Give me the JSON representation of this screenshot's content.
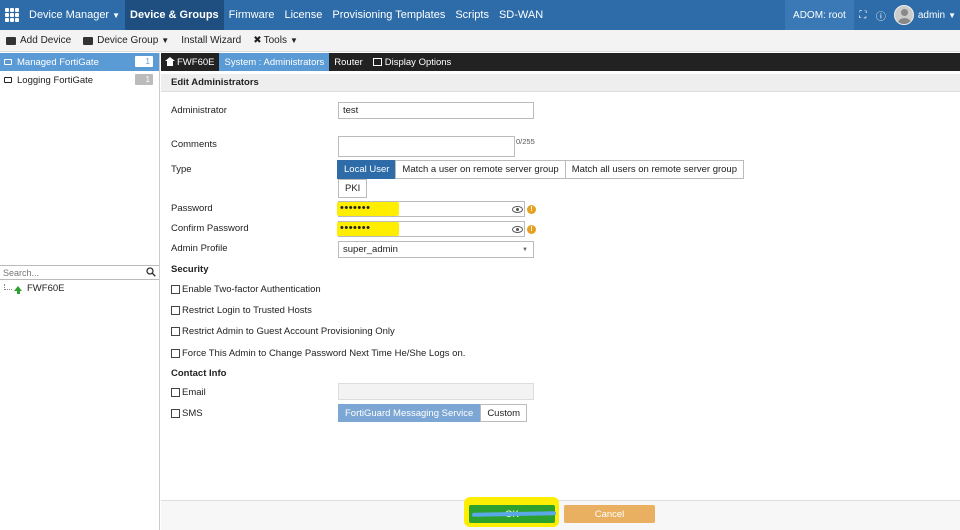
{
  "topbar": {
    "nav": [
      "Device Manager",
      "Device & Groups",
      "Firmware",
      "License",
      "Provisioning Templates",
      "Scripts",
      "SD-WAN"
    ],
    "adom": "ADOM: root",
    "user": "admin",
    "accent": "#2d6ca8"
  },
  "toolbar": {
    "add_device": "Add Device",
    "device_group": "Device Group",
    "install_wizard": "Install Wizard",
    "tools": "Tools"
  },
  "sidebar": {
    "items": [
      {
        "label": "Managed FortiGate",
        "count": "1"
      },
      {
        "label": "Logging FortiGate",
        "count": "1"
      }
    ],
    "search_placeholder": "Search...",
    "tree_item": "FWF60E"
  },
  "tabs": {
    "device": "FWF60E",
    "system": "System : Administrators",
    "router": "Router",
    "display": "Display Options"
  },
  "form": {
    "heading": "Edit Administrators",
    "administrator_label": "Administrator",
    "administrator_value": "test",
    "comments_label": "Comments",
    "comments_counter": "0/255",
    "type_label": "Type",
    "type_options": [
      "Local User",
      "Match a user on remote server group",
      "Match all users on remote server group",
      "PKI"
    ],
    "password_label": "Password",
    "password_value": "•••••••",
    "confirm_label": "Confirm Password",
    "confirm_value": "•••••••",
    "profile_label": "Admin Profile",
    "profile_value": "super_admin",
    "security_label": "Security",
    "security_options": [
      "Enable Two-factor Authentication",
      "Restrict Login to Trusted Hosts",
      "Restrict Admin to Guest Account Provisioning Only",
      "Force This Admin to Change Password Next Time He/She Logs on."
    ],
    "contact_label": "Contact Info",
    "email_label": "Email",
    "sms_label": "SMS",
    "sms_options": [
      "FortiGuard Messaging Service",
      "Custom"
    ]
  },
  "footer": {
    "ok": "OK",
    "cancel": "Cancel"
  }
}
